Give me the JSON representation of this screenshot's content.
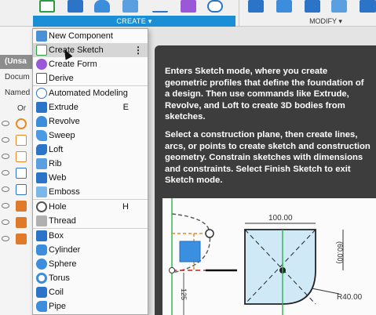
{
  "toolbar": {
    "create_label": "CREATE ▾",
    "modify_label": "MODIFY ▾"
  },
  "background_panel": {
    "header": "(Unsa",
    "row1": "Docum",
    "row2": "Named",
    "row3": "Or"
  },
  "menu": {
    "items": [
      {
        "label": "New Component",
        "icon": "new-component-icon",
        "shortcut": ""
      },
      {
        "label": "Create Sketch",
        "icon": "create-sketch-icon",
        "shortcut": ""
      },
      {
        "label": "Create Form",
        "icon": "create-form-icon",
        "shortcut": ""
      },
      {
        "label": "Derive",
        "icon": "derive-icon",
        "shortcut": ""
      },
      {
        "label": "Automated Modeling",
        "icon": "automated-modeling-icon",
        "shortcut": ""
      },
      {
        "label": "Extrude",
        "icon": "extrude-icon",
        "shortcut": "E"
      },
      {
        "label": "Revolve",
        "icon": "revolve-icon",
        "shortcut": ""
      },
      {
        "label": "Sweep",
        "icon": "sweep-icon",
        "shortcut": ""
      },
      {
        "label": "Loft",
        "icon": "loft-icon",
        "shortcut": ""
      },
      {
        "label": "Rib",
        "icon": "rib-icon",
        "shortcut": ""
      },
      {
        "label": "Web",
        "icon": "web-icon",
        "shortcut": ""
      },
      {
        "label": "Emboss",
        "icon": "emboss-icon",
        "shortcut": ""
      },
      {
        "label": "Hole",
        "icon": "hole-icon",
        "shortcut": "H"
      },
      {
        "label": "Thread",
        "icon": "thread-icon",
        "shortcut": ""
      },
      {
        "label": "Box",
        "icon": "box-icon",
        "shortcut": ""
      },
      {
        "label": "Cylinder",
        "icon": "cylinder-icon",
        "shortcut": ""
      },
      {
        "label": "Sphere",
        "icon": "sphere-icon",
        "shortcut": ""
      },
      {
        "label": "Torus",
        "icon": "torus-icon",
        "shortcut": ""
      },
      {
        "label": "Coil",
        "icon": "coil-icon",
        "shortcut": ""
      },
      {
        "label": "Pipe",
        "icon": "pipe-icon",
        "shortcut": ""
      }
    ],
    "highlighted": "Create Sketch",
    "kebab": "⋮"
  },
  "tooltip": {
    "paragraph1": "Enters Sketch mode, where you create geometric profiles that define the foundation of a design. Then use commands like Extrude, Revolve, and Loft to create 3D bodies from sketches.",
    "paragraph2": "Select a construction plane, then create lines, arcs, or points to create sketch and construction geometry. Constrain sketches with dimensions and constraints. Select Finish Sketch to exit Sketch mode.",
    "image": {
      "dim_width": "100.00",
      "dim_height": "(60.00)",
      "dim_radius": "R40.00",
      "dim_vertical": "125"
    }
  },
  "colors": {
    "accent": "#1a8fd6",
    "tooltip_bg": "#3d3d3d",
    "sketch_fill": "#cfe9f6",
    "constraint_red": "#d02020",
    "construction_orange": "#e8892a",
    "axis_green": "#2bb34a"
  }
}
